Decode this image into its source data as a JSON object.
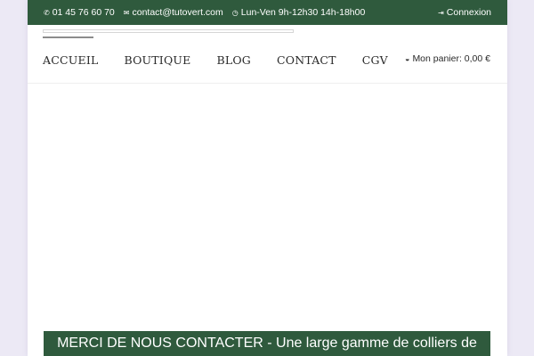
{
  "topbar": {
    "phone": "01 45 76 60 70",
    "email": "contact@tutovert.com",
    "hours": "Lun-Ven 9h-12h30 14h-18h00",
    "login": "Connexion"
  },
  "nav": {
    "items": [
      "ACCUEIL",
      "BOUTIQUE",
      "BLOG",
      "CONTACT",
      "CGV"
    ]
  },
  "cart": {
    "label": "Mon panier: 0,00 €"
  },
  "banner": {
    "text": "MERCI DE NOUS CONTACTER - Une large gamme de colliers de"
  },
  "colors": {
    "brand_green": "#2f5a3d",
    "page_bg": "#ece9f5"
  },
  "icons": {
    "phone": "phone-icon",
    "email": "envelope-icon",
    "hours": "clock-icon",
    "login": "login-icon",
    "cart": "cart-icon"
  }
}
